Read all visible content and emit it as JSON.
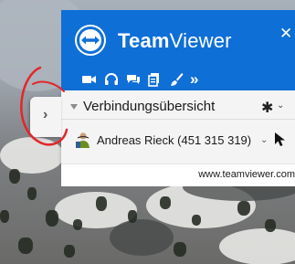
{
  "app": {
    "brand_bold": "Team",
    "brand_regular": "Viewer",
    "close_glyph": "✕"
  },
  "toolbar": {
    "icons": [
      "video-camera-icon",
      "headset-icon",
      "chat-icon",
      "file-transfer-icon",
      "brush-icon",
      "more-chevrons-icon"
    ],
    "more_glyph": "»"
  },
  "section": {
    "title": "Verbindungsübersicht",
    "gear_glyph": "✱",
    "chevron_glyph": "⌄"
  },
  "contact": {
    "name": "Andreas Rieck (451 315 319)",
    "chevron_glyph": "⌄"
  },
  "footer": {
    "url": "www.teamviewer.com"
  },
  "side_tab": {
    "glyph": "›"
  },
  "colors": {
    "brand_blue": "#0e6fd7",
    "panel_bg": "#f4f4f4",
    "annotation_red": "#e2262b"
  }
}
